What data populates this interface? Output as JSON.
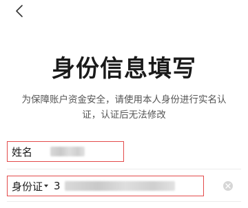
{
  "header": {
    "back_icon": "chevron-left-icon"
  },
  "page": {
    "title": "身份信息填写",
    "subtitle": "为保障账户资金安全，请使用本人身份进行实名认证，认证后无法修改"
  },
  "form": {
    "name_field": {
      "label": "姓名",
      "value_masked": true
    },
    "id_field": {
      "type_label": "身份证",
      "value_visible_prefix": "3",
      "value_masked": true,
      "clear_icon": "clear-circle-icon"
    },
    "highlight_color": "#e34a4a"
  }
}
